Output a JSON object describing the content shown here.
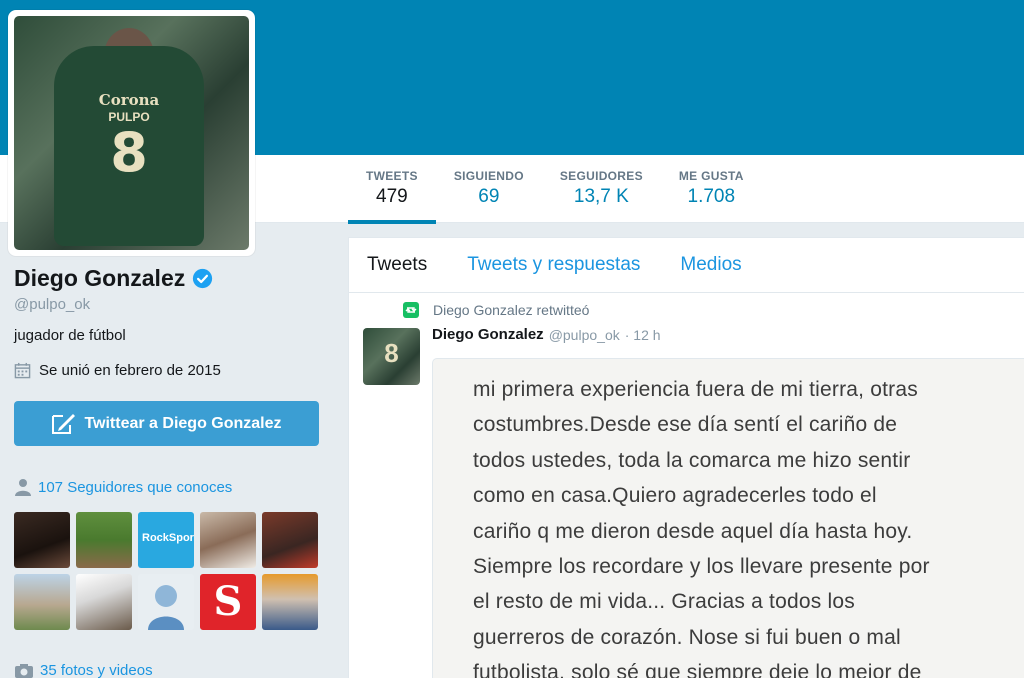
{
  "profile": {
    "name": "Diego Gonzalez",
    "handle": "@pulpo_ok",
    "bio": "jugador de fútbol",
    "joined": "Se unió en febrero de 2015",
    "avatar_jersey": {
      "brand": "Corona",
      "name": "PULPO",
      "number": "8"
    }
  },
  "stats": [
    {
      "label": "TWEETS",
      "value": "479"
    },
    {
      "label": "SIGUIENDO",
      "value": "69"
    },
    {
      "label": "SEGUIDORES",
      "value": "13,7 K"
    },
    {
      "label": "ME GUSTA",
      "value": "1.708"
    }
  ],
  "tweet_to_button": "Twittear a Diego Gonzalez",
  "followers_you_know": "107 Seguidores que conoces",
  "photos_videos": "35 fotos y videos",
  "timeline_tabs": [
    "Tweets",
    "Tweets y respuestas",
    "Medios"
  ],
  "tweet": {
    "retweeted_by": "Diego Gonzalez retwitteó",
    "author": "Diego Gonzalez",
    "handle": "@pulpo_ok",
    "time": "· 12 h",
    "media_text_lines": [
      "mi primera experiencia fuera de mi tierra, otras",
      "costumbres.Desde ese día sentí el cariño de",
      "todos ustedes, toda la comarca me hizo sentir",
      "como en casa.Quiero agradecerles todo el",
      "cariño q me dieron desde aquel día hasta hoy.",
      "Siempre los recordare y los llevare presente por",
      "el resto de mi vida... Gracias a todos los",
      "guerreros de corazón. Nose si fui buen o mal",
      "futbolista, solo sé que siempre deje lo mejor de"
    ]
  },
  "colors": {
    "header": "#0084b4",
    "link": "#1b95e0",
    "button": "#3b9ed3",
    "verified": "#1da1f2",
    "retweet": "#17bf63"
  }
}
